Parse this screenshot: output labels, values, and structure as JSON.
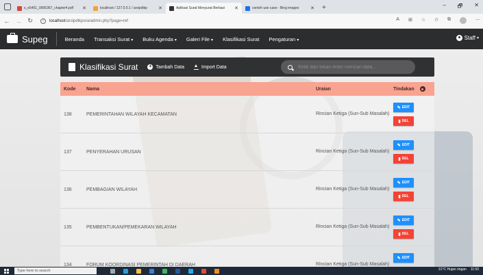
{
  "browser": {
    "tabs": [
      {
        "label": "s_e5451_0606367_chapter4.pdf",
        "color": "#d9463b",
        "active": false
      },
      {
        "label": "localhost / 127.0.0.1 / arsipdikp",
        "color": "#f2a33a",
        "active": false
      },
      {
        "label": "Aplikasi Surat Menyurat Berbasi",
        "color": "#333333",
        "active": true
      },
      {
        "label": "contoh use case - Bing images",
        "color": "#1a73e8",
        "active": false
      }
    ],
    "new_tab": "+",
    "window_controls": {
      "minimize": "–",
      "restore": "🗗",
      "close": "✕"
    },
    "url_host": "localhost",
    "url_path": "/arsipdikpora/admin.php?page=ref"
  },
  "app": {
    "brand": "Supeg",
    "menu": [
      {
        "label": "Beranda",
        "dropdown": false
      },
      {
        "label": "Transaksi Surat",
        "dropdown": true
      },
      {
        "label": "Buku Agenda",
        "dropdown": true
      },
      {
        "label": "Galeri File",
        "dropdown": true
      },
      {
        "label": "Klasifikasi Surat",
        "dropdown": false
      },
      {
        "label": "Pengaturan",
        "dropdown": true
      }
    ],
    "user": "Staff"
  },
  "panel": {
    "title": "Klasifikasi Surat",
    "add_label": "Tambah Data",
    "import_label": "Import Data",
    "search_placeholder": "Ketik dan tekan enter mencari data..."
  },
  "table": {
    "headers": {
      "kode": "Kode",
      "nama": "Nama",
      "uraian": "Uraian",
      "tindakan": "Tindakan"
    },
    "edit_label": "EDIT",
    "del_label": "DEL",
    "rows": [
      {
        "kode": "138",
        "nama": "PEMERINTAHAN WILAYAH KECAMATAN",
        "uraian": "Rincian Ketiga (Sun-Sub Masalah)"
      },
      {
        "kode": "137",
        "nama": "PENYERAHAN URUSAN",
        "uraian": "Rincian Ketiga (Sun-Sub Masalah)"
      },
      {
        "kode": "136",
        "nama": "PEMBAGIAN WILAYAH",
        "uraian": "Rincian Ketiga (Sun-Sub Masalah)"
      },
      {
        "kode": "135",
        "nama": "PEMBENTUKAN/PEMEKARAN WILAYAH",
        "uraian": "Rincian Ketiga (Sun-Sub Masalah)"
      },
      {
        "kode": "134",
        "nama": "FORUM KOORDINASI PEMERINTAH DI DAERAH",
        "uraian": "Rincian Ketiga (Sun-Sub Masalah)"
      }
    ]
  },
  "taskbar": {
    "search": "Type here to search",
    "weather": "31°C  Hujan ringan",
    "time": "11:50"
  },
  "colors": {
    "navbar": "#2b2d2f",
    "table_header": "#f9a391",
    "edit": "#1e90ff",
    "del": "#f44336"
  }
}
